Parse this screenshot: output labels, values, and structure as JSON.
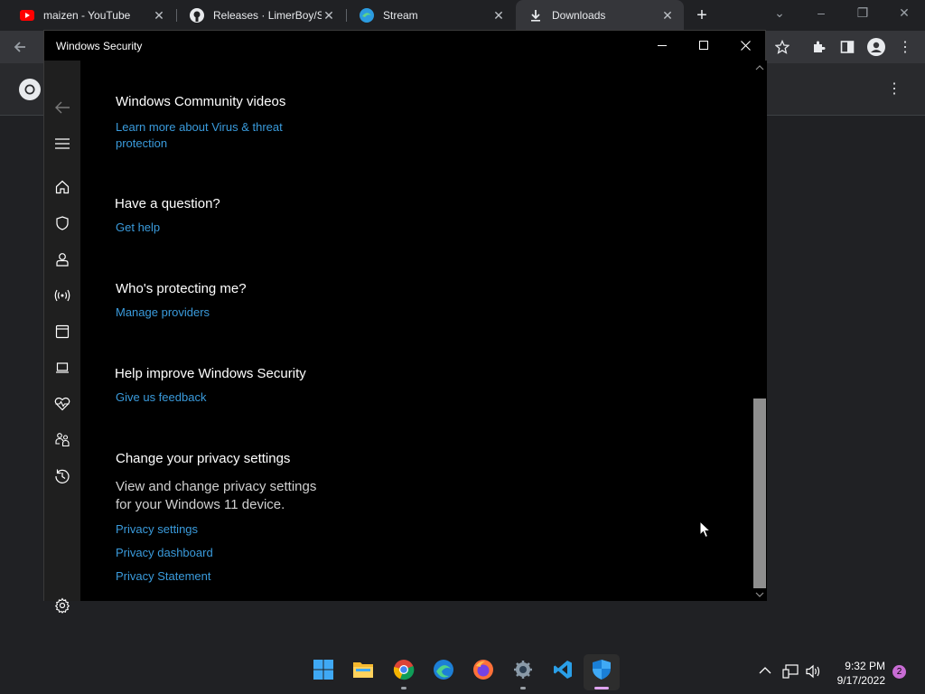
{
  "browser": {
    "tabs": [
      {
        "title": "maizen - YouTube",
        "icon": "youtube-icon"
      },
      {
        "title": "Releases · LimerBoy/Sto",
        "icon": "github-icon"
      },
      {
        "title": "Stream",
        "icon": "edge-icon"
      },
      {
        "title": "Downloads",
        "icon": "download-icon",
        "active": true
      }
    ]
  },
  "security_window": {
    "title": "Windows Security",
    "sections": {
      "community": {
        "heading": "Windows Community videos",
        "link": "Learn more about Virus & threat protection"
      },
      "question": {
        "heading": "Have a question?",
        "link": "Get help"
      },
      "protecting": {
        "heading": "Who's protecting me?",
        "link": "Manage providers"
      },
      "improve": {
        "heading": "Help improve Windows Security",
        "link": "Give us feedback"
      },
      "privacy": {
        "heading": "Change your privacy settings",
        "description": "View and change privacy settings for your Windows 11 device.",
        "links": [
          "Privacy settings",
          "Privacy dashboard",
          "Privacy Statement"
        ]
      }
    },
    "nav_icons": [
      "back-arrow-icon",
      "hamburger-menu-icon",
      "home-icon",
      "shield-icon",
      "person-icon",
      "wireless-icon",
      "app-browser-icon",
      "laptop-icon",
      "health-heart-icon",
      "family-icon",
      "history-icon",
      "settings-gear-icon"
    ]
  },
  "taskbar": {
    "apps": [
      "windows-start-icon",
      "file-explorer-icon",
      "chrome-icon",
      "edge-icon",
      "firefox-icon",
      "settings-icon",
      "vscode-icon",
      "windows-security-icon"
    ],
    "time": "9:32 PM",
    "date": "9/17/2022",
    "notification_count": "2"
  },
  "colors": {
    "link": "#3a9bdc",
    "window_bg": "#000000",
    "nav_bg": "#1f1f1f"
  }
}
